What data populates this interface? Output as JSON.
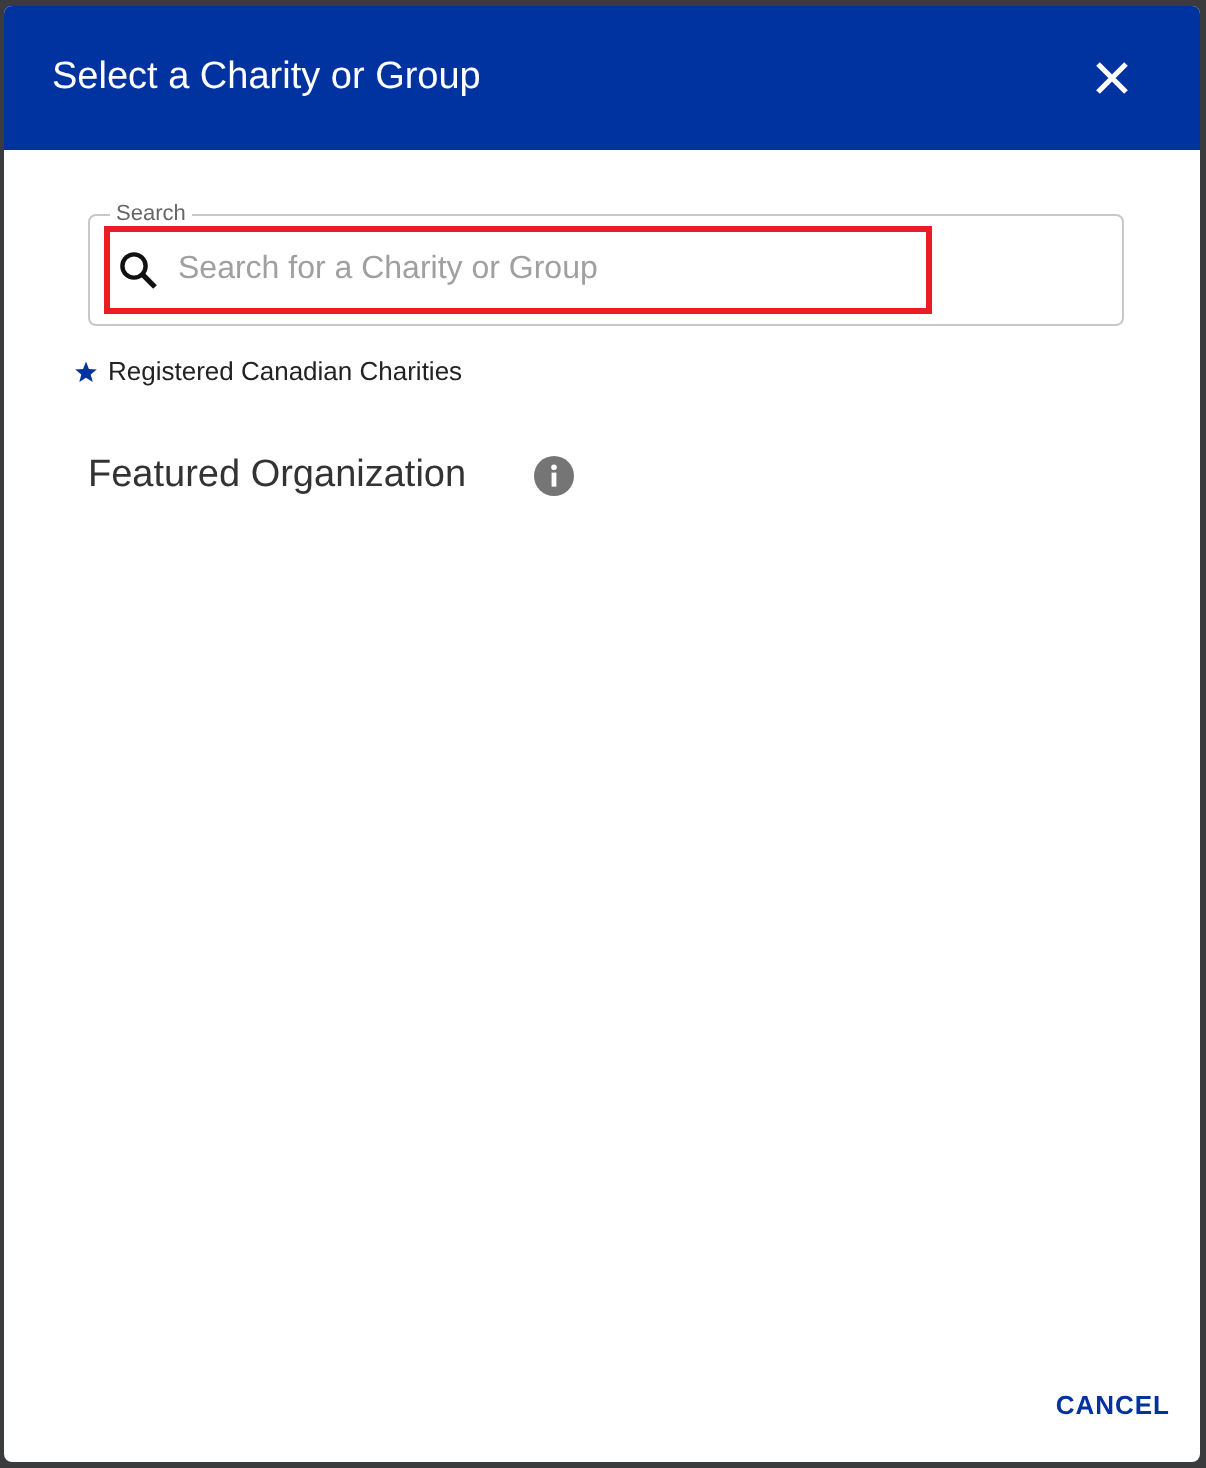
{
  "dialog": {
    "title": "Select a Charity or Group"
  },
  "search": {
    "label": "Search",
    "placeholder": "Search for a Charity or Group",
    "highlighted": true
  },
  "legend": {
    "text": "Registered Canadian Charities"
  },
  "featured": {
    "heading": "Featured Organization"
  },
  "buttons": [
    "CANCEL"
  ]
}
